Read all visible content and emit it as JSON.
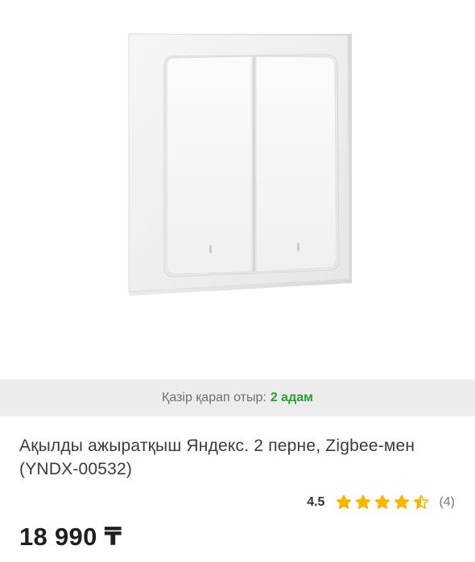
{
  "product": {
    "image_alt_icon": "wall-switch-image",
    "watchers_label": "Қазір қарап отыр:",
    "watchers_count": "2 адам",
    "title": "Ақылды ажыратқыш Яндекс. 2 перне, Zigbee-мен (YNDX-00532)",
    "rating_score": "4.5",
    "rating_value": 4.5,
    "rating_max": 5,
    "reviews": "(4)",
    "price": "18 990 ₸"
  },
  "colors": {
    "watchers_bar": "#ececec",
    "watchers_count": "#2e9b3a",
    "star": "#f5b800",
    "text": "#3b3b3b"
  }
}
